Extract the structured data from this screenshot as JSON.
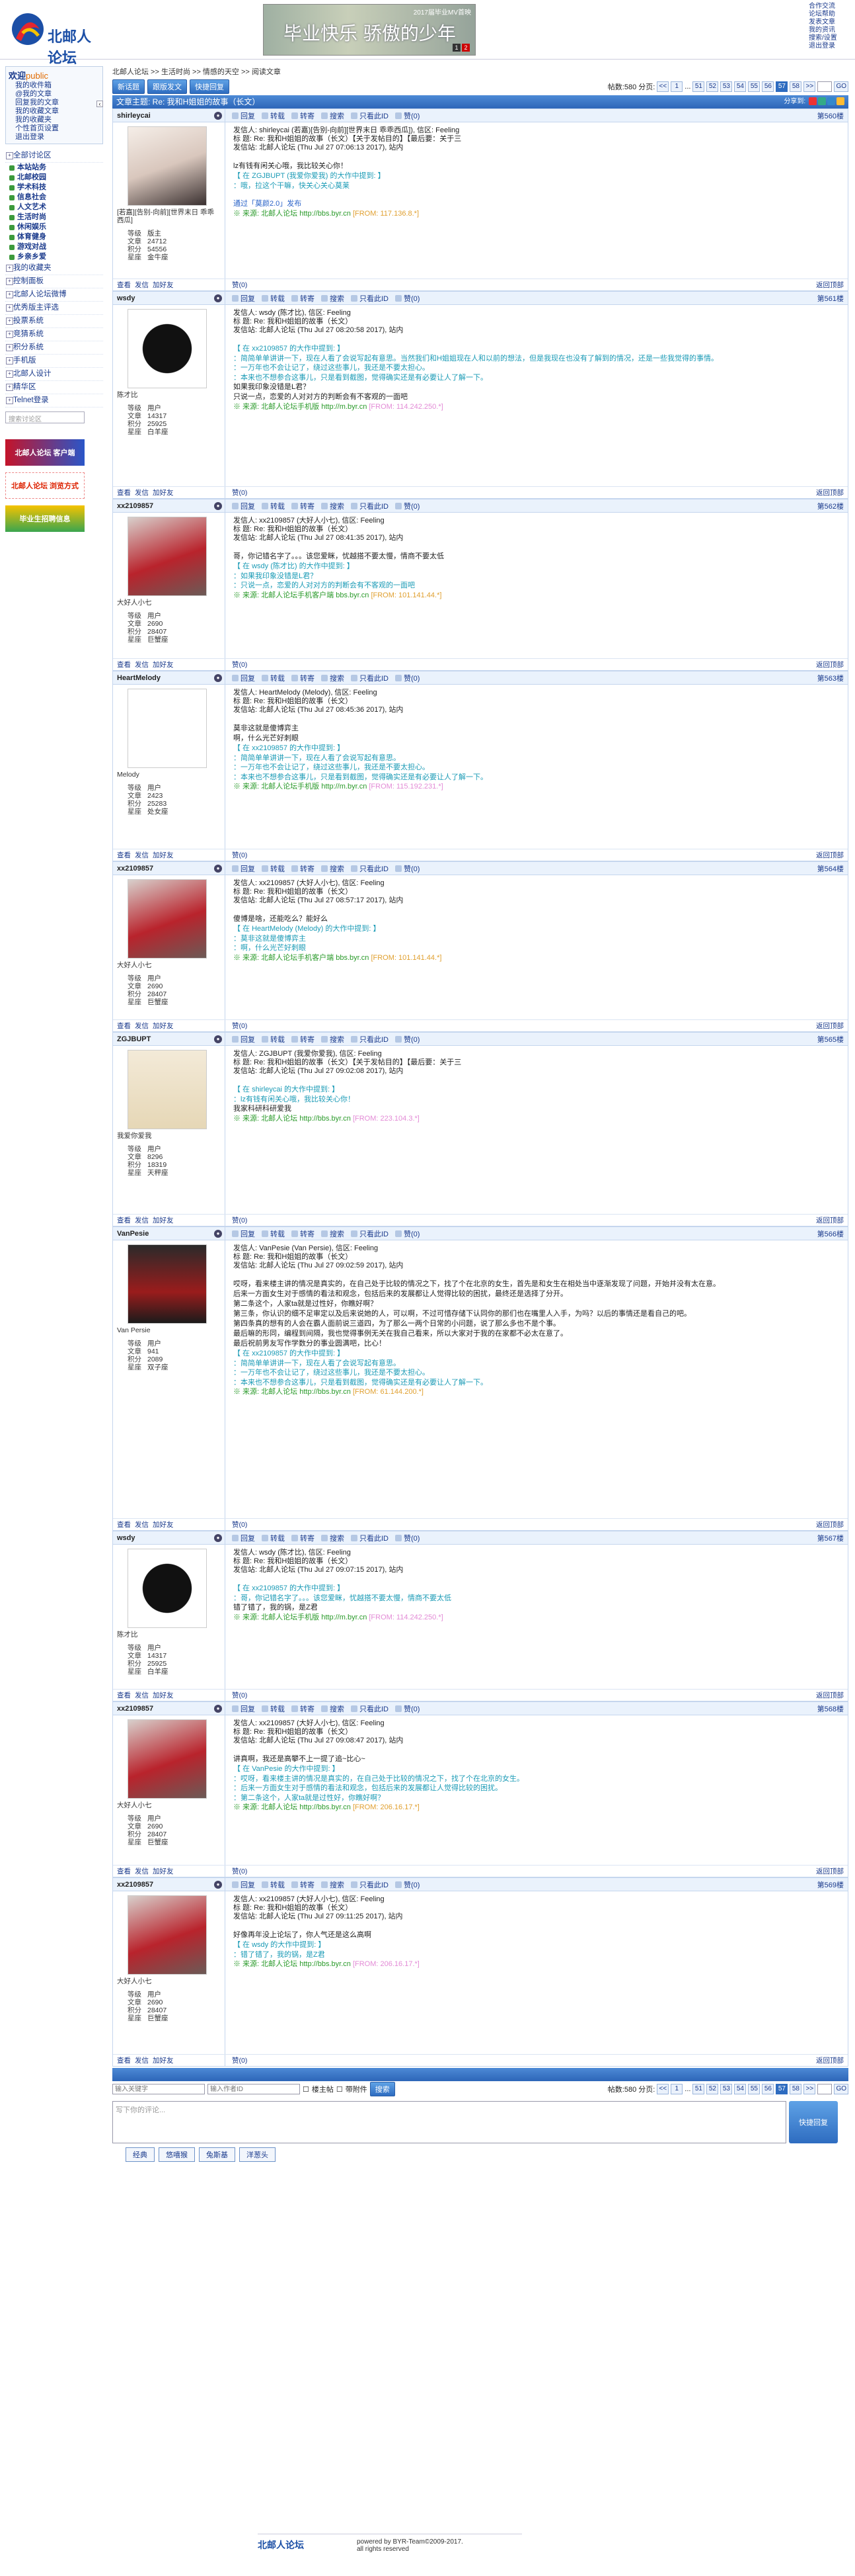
{
  "site": {
    "logo_text": "北邮人论坛",
    "banner_title": "2017届毕业MV首映",
    "banner_slogan": "毕业快乐  骄傲的少年",
    "banner_pages": [
      "1",
      "2"
    ],
    "top_links": [
      "合作交流",
      "论坛帮助",
      "发表文章",
      "我的资讯",
      "搜索/设置",
      "退出登录"
    ]
  },
  "sidebar": {
    "welcome": "欢迎",
    "user": "public",
    "links": [
      "我的收件箱",
      "@我的文章",
      "回复我的文章",
      "我的收藏文章",
      "我的收藏夹",
      "个性首页设置",
      "退出登录"
    ],
    "nav_top": "全部讨论区",
    "subs": [
      "本站站务",
      "北邮校园",
      "学术科技",
      "信息社会",
      "人文艺术",
      "生活时尚",
      "休闲娱乐",
      "体育健身",
      "游戏对战",
      "乡亲乡爱"
    ],
    "groups": [
      "我的收藏夹",
      "控制面板",
      "北邮人论坛微博",
      "优秀版主评选",
      "投票系统",
      "竞猜系统",
      "积分系统",
      "手机版",
      "北邮人设计",
      "精华区",
      "Telnet登录"
    ],
    "search_placeholder": "搜索讨论区",
    "ads": [
      "北邮人论坛 客户端",
      "北邮人论坛 浏览方式",
      "毕业生招聘信息"
    ]
  },
  "main": {
    "breadcrumb": "北邮人论坛 >> 生活时尚 >> 情感的天空 >> 阅读文章",
    "toolbar": {
      "new_post": "新话题",
      "hot": "跟版发文",
      "quick": "快捷回复",
      "count_label": "帖数:580",
      "pages_label": "分页:",
      "pages": [
        "<<",
        "1",
        "...",
        "51",
        "52",
        "53",
        "54",
        "55",
        "56",
        "57",
        "58",
        ">>"
      ],
      "current": "57",
      "go": "GO"
    },
    "title": "文章主题: Re: 我和H姐姐的故事（长文）",
    "share": "分享到:"
  },
  "post_actions": [
    "回复",
    "转载",
    "转寄",
    "搜索",
    "只看此ID",
    "赞(0)"
  ],
  "foot_actions": [
    "查看",
    "发信",
    "加好友"
  ],
  "foot_like": [
    "赞(0)"
  ],
  "to_top": "返回顶部",
  "user_labels": [
    "等级",
    "文章",
    "积分",
    "星座"
  ],
  "posts": [
    {
      "name": "shirleycai",
      "floor": "第560楼",
      "nick": "[若嘉][告别-向前][世界末日 乖乖西瓜]",
      "level": "版主",
      "articles": "24712",
      "points": "54556",
      "sign": "金牛座",
      "meta": [
        "发信人: shirleycai (若嘉)[告别-向前][世界末日 乖乖西瓜]), 信区: Feeling",
        "标  题: Re: 我和H姐姐的故事（长文）【关于发帖目的】【最后要：关于三",
        "发信站: 北邮人论坛 (Thu Jul 27 07:06:13 2017), 站内"
      ],
      "body": [
        "lz有钱有闲关心哦，我比较关心你！",
        "【 在 ZGJBUPT (我爱你爱我) 的大作中提到: 】",
        "：哦，拉这个干嘛，快关心关心莫莱"
      ],
      "link": "通过「莫颜2.0」发布",
      "src": "※ 来源: 北邮人论坛 http://bbs.byr.cn",
      "ip": "[FROM: 117.136.8.*]"
    },
    {
      "name": "wsdy",
      "floor": "第561楼",
      "nick": "陈才比",
      "level": "用户",
      "articles": "14317",
      "points": "25925",
      "sign": "白羊座",
      "meta": [
        "发信人: wsdy (陈才比), 信区: Feeling",
        "标  题: Re: 我和H姐姐的故事（长文）",
        "发信站: 北邮人论坛 (Thu Jul 27 08:20:58 2017), 站内"
      ],
      "body": [
        "【 在 xx2109857 的大作中提到: 】",
        "：简简单单讲讲一下，现在人看了会说写起有意思。当然我们和H姐姐现在人和以前的想法，但是我现在也没有了解到的情况，还是一些我觉得的事情。",
        "：一万年也不会让记了，绕过这些事儿，我还是不要太担心。",
        "：本来也不想参合这事儿，只是看到截图，觉得确实还是有必要让人了解一下。",
        "",
        "如果我印象没错是L君？",
        "",
        "只说一点，恋爱的人对对方的判断会有不客观的一面吧"
      ],
      "link": "",
      "src": "※ 来源: 北邮人论坛手机版 http://m.byr.cn",
      "ip": "[FROM: 114.242.250.*]"
    },
    {
      "name": "xx2109857",
      "floor": "第562楼",
      "nick": "大好人小七",
      "level": "用户",
      "articles": "2690",
      "points": "28407",
      "sign": "巨蟹座",
      "meta": [
        "发信人: xx2109857 (大好人小七), 信区: Feeling",
        "标  题: Re: 我和H姐姐的故事（长文）",
        "发信站: 北邮人论坛 (Thu Jul 27 08:41:35 2017), 站内"
      ],
      "body": [
        "",
        "哥，你记错名字了。。。该您爱眯，忧越搭不要太慢，情商不要太低",
        "",
        "【 在 wsdy (陈才比) 的大作中提到: 】",
        "：如果我印象没错是L君？",
        "：只说一点，恋爱的人对对方的判断会有不客观的一面吧"
      ],
      "link": "",
      "src": "※ 来源: 北邮人论坛手机客户端 bbs.byr.cn",
      "ip": "[FROM: 101.141.44.*]"
    },
    {
      "name": "HeartMelody",
      "floor": "第563楼",
      "nick": "Melody",
      "level": "用户",
      "articles": "2423",
      "points": "25283",
      "sign": "处女座",
      "meta": [
        "发信人: HeartMelody (Melody), 信区: Feeling",
        "标  题: Re: 我和H姐姐的故事（长文）",
        "发信站: 北邮人论坛 (Thu Jul 27 08:45:36 2017), 站内"
      ],
      "body": [
        "莫非这就是傻博弈主",
        "啊，什么光芒好刺眼",
        "【 在 xx2109857 的大作中提到: 】",
        "：简简单单讲讲一下，现在人看了会说写起有意思。",
        "：一万年也不会让记了，绕过这些事儿，我还是不要太担心。",
        "：本来也不想参合这事儿，只是看到截图，觉得确实还是有必要让人了解一下。"
      ],
      "link": "",
      "src": "※ 来源: 北邮人论坛手机版 http://m.byr.cn",
      "ip": "[FROM: 115.192.231.*]"
    },
    {
      "name": "xx2109857",
      "floor": "第564楼",
      "nick": "大好人小七",
      "level": "用户",
      "articles": "2690",
      "points": "28407",
      "sign": "巨蟹座",
      "meta": [
        "发信人: xx2109857 (大好人小七), 信区: Feeling",
        "标  题: Re: 我和H姐姐的故事（长文）",
        "发信站: 北邮人论坛 (Thu Jul 27 08:57:17 2017), 站内"
      ],
      "body": [
        "",
        "傻博是啥，还能吃么？能好么",
        "",
        "【 在 HeartMelody (Melody) 的大作中提到: 】",
        "：莫非这就是傻博弈主",
        "：啊，什么光芒好刺眼"
      ],
      "link": "",
      "src": "※ 来源: 北邮人论坛手机客户端 bbs.byr.cn",
      "ip": "[FROM: 101.141.44.*]"
    },
    {
      "name": "ZGJBUPT",
      "floor": "第565楼",
      "nick": "我爱你爱我",
      "level": "用户",
      "articles": "8296",
      "points": "18319",
      "sign": "天秤座",
      "meta": [
        "发信人: ZGJBUPT (我爱你爱我), 信区: Feeling",
        "标  题: Re: 我和H姐姐的故事（长文）【关于发帖目的】【最后要：关于三",
        "发信站: 北邮人论坛 (Thu Jul 27 09:02:08 2017), 站内"
      ],
      "body": [
        "",
        "【 在 shirleycai 的大作中提到: 】",
        "：lz有钱有闲关心哦，我比较关心你！",
        "",
        "",
        "我家科研科研爱我"
      ],
      "link": "",
      "src": "※ 来源: 北邮人论坛 http://bbs.byr.cn",
      "ip": "[FROM: 223.104.3.*]"
    },
    {
      "name": "VanPesie",
      "floor": "第566楼",
      "nick": "Van Persie",
      "level": "用户",
      "articles": "941",
      "points": "2089",
      "sign": "双子座",
      "meta": [
        "发信人: VanPesie (Van Persie), 信区: Feeling",
        "标  题: Re: 我和H姐姐的故事（长文）",
        "发信站: 北邮人论坛 (Thu Jul 27 09:02:59 2017), 站内"
      ],
      "body": [
        "",
        "哎呀，看来楼主讲的情况是真实的，在自己处于比较的情况之下，找了个在北京的女生，首先是和女生在相处当中逐渐发现了问题，开始并没有太在意。",
        "后来一方面女生对于感情的看法和观念，包括后来的发展都让人觉得比较的困扰，最终还是选择了分开。",
        "第二条这个，人家ta就是过性好，你瞧好啊？",
        "第三条，你认识的细不足审定以及后来说她的人，可以啊，不过可惜存储下认同你的那们也在嘴里人入手，为吗？以后的事情还是看自己的吧。",
        "第四条真的想有的人会在霸人面前说三道四，为了那么一两个日常的小问题，说了那么多也不是个事。",
        "最后嘛的形同，编程到间隔，我也觉得事例无关在我自己看来，所以大家对于我的在家都不必太在意了。",
        "",
        "最后祝前男友写作学数分的事业圆满吧，比心！",
        "【 在 xx2109857 的大作中提到: 】",
        "：简简单单讲讲一下，现在人看了会说写起有意思。",
        "：一万年也不会让记了，绕过这些事儿，我还是不要太担心。",
        "：本来也不想参合这事儿，只是看到截图，觉得确实还是有必要让人了解一下。"
      ],
      "link": "",
      "src": "※ 来源: 北邮人论坛 http://bbs.byr.cn",
      "ip": "[FROM: 61.144.200.*]"
    },
    {
      "name": "wsdy",
      "floor": "第567楼",
      "nick": "陈才比",
      "level": "用户",
      "articles": "14317",
      "points": "25925",
      "sign": "白羊座",
      "meta": [
        "发信人: wsdy (陈才比), 信区: Feeling",
        "标  题: Re: 我和H姐姐的故事（长文）",
        "发信站: 北邮人论坛 (Thu Jul 27 09:07:15 2017), 站内"
      ],
      "body": [
        "",
        "【 在 xx2109857 的大作中提到: 】",
        "：哥，你记错名字了。。。该您爱眯，忧越搭不要太慢，情商不要太低",
        "",
        "错了错了，我的锅，是Z君"
      ],
      "link": "",
      "src": "※ 来源: 北邮人论坛手机版 http://m.byr.cn",
      "ip": "[FROM: 114.242.250.*]"
    },
    {
      "name": "xx2109857",
      "floor": "第568楼",
      "nick": "大好人小七",
      "level": "用户",
      "articles": "2690",
      "points": "28407",
      "sign": "巨蟹座",
      "meta": [
        "发信人: xx2109857 (大好人小七), 信区: Feeling",
        "标  题: Re: 我和H姐姐的故事（长文）",
        "发信站: 北邮人论坛 (Thu Jul 27 09:08:47 2017), 站内"
      ],
      "body": [
        "",
        "讲真啊，我还是高攀不上一提了追~比心~",
        "【 在 VanPesie 的大作中提到: 】",
        "：哎呀，看来楼主讲的情况是真实的，在自己处于比较的情况之下，找了个在北京的女生。",
        "：后来一方面女生对于感情的看法和观念，包括后来的发展都让人觉得比较的困扰。",
        "：第二条这个，人家ta就是过性好，你瞧好啊？"
      ],
      "link": "",
      "src": "※ 来源: 北邮人论坛 http://bbs.byr.cn",
      "ip": "[FROM: 206.16.17.*]"
    },
    {
      "name": "xx2109857",
      "floor": "第569楼",
      "nick": "大好人小七",
      "level": "用户",
      "articles": "2690",
      "points": "28407",
      "sign": "巨蟹座",
      "meta": [
        "发信人: xx2109857 (大好人小七), 信区: Feeling",
        "标  题: Re: 我和H姐姐的故事（长文）",
        "发信站: 北邮人论坛 (Thu Jul 27 09:11:25 2017), 站内"
      ],
      "body": [
        "",
        "",
        "好像再年没上论坛了，你人气还是这么高啊",
        "【 在 wsdy 的大作中提到: 】",
        "：错了错了，我的锅，是Z君"
      ],
      "link": "",
      "src": "※ 来源: 北邮人论坛 http://bbs.byr.cn",
      "ip": "[FROM: 206.16.17.*]"
    }
  ],
  "bottom": {
    "author_placeholder": "输入关键字",
    "search_placeholder": "输入作者ID",
    "only_lz": "楼主帖",
    "with_attach": "带附件",
    "search_btn": "搜索",
    "reply_placeholder": "写下你的评论...",
    "reply_btn": "快捷回复",
    "emotions": [
      "经典",
      "悠嘻猴",
      "兔斯基",
      "洋葱头"
    ]
  },
  "footer": {
    "logo": "北邮人论坛",
    "powered": "powered by BYR-Team©2009-2017.",
    "rights": "all rights reserved"
  },
  "colors": {
    "accent": "#2e6cc0",
    "quote": "#1b9bb6",
    "source": "#2a9a2a"
  }
}
